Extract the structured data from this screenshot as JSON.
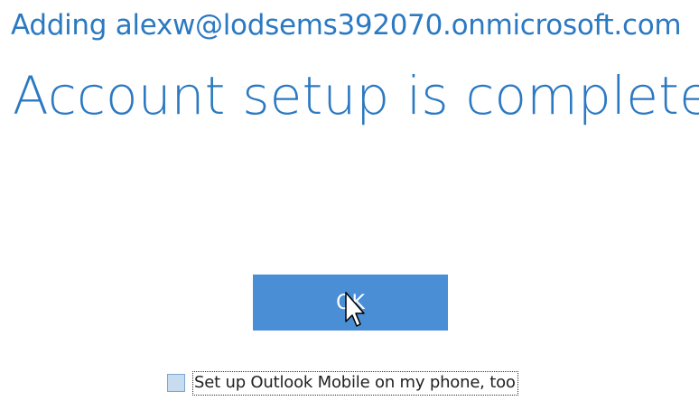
{
  "header": {
    "subtitle": "Adding alexw@lodsems392070.onmicrosoft.com",
    "title": "Account setup is complete"
  },
  "actions": {
    "ok_label": "OK"
  },
  "options": {
    "mobile_setup_label": "Set up Outlook Mobile on my phone, too",
    "mobile_setup_checked": false
  },
  "colors": {
    "accent": "#2b79c2",
    "button": "#4a8fd6"
  },
  "icons": {
    "cursor": "mouse-pointer-icon"
  }
}
